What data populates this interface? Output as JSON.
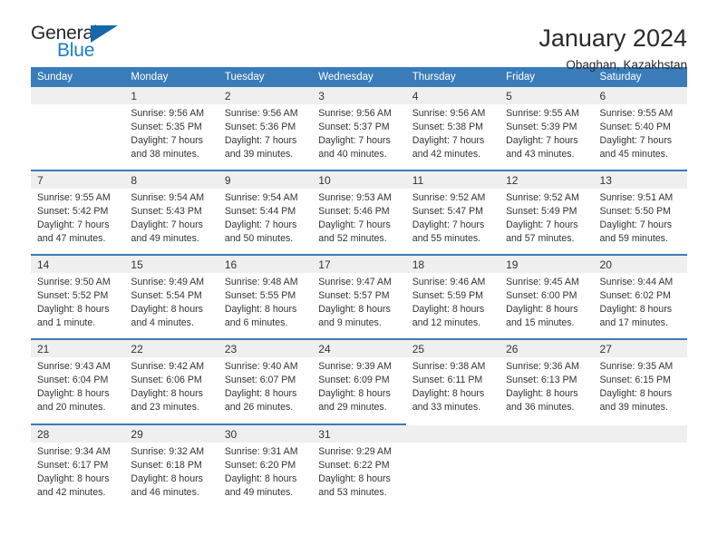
{
  "logo": {
    "word_top": "General",
    "word_bottom": "Blue",
    "triangle_color": "#1667ab",
    "blue_color": "#1c7ec6"
  },
  "header": {
    "title": "January 2024",
    "subtitle": "Obaghan, Kazakhstan"
  },
  "theme": {
    "header_bg": "#3a7cba",
    "daynum_bg": "#efefef",
    "text": "#333333"
  },
  "weekday_headers": [
    "Sunday",
    "Monday",
    "Tuesday",
    "Wednesday",
    "Thursday",
    "Friday",
    "Saturday"
  ],
  "weeks": [
    {
      "days": [
        {
          "num": "",
          "sunrise": "",
          "sunset": "",
          "daylight1": "",
          "daylight2": ""
        },
        {
          "num": "1",
          "sunrise": "Sunrise: 9:56 AM",
          "sunset": "Sunset: 5:35 PM",
          "daylight1": "Daylight: 7 hours",
          "daylight2": "and 38 minutes."
        },
        {
          "num": "2",
          "sunrise": "Sunrise: 9:56 AM",
          "sunset": "Sunset: 5:36 PM",
          "daylight1": "Daylight: 7 hours",
          "daylight2": "and 39 minutes."
        },
        {
          "num": "3",
          "sunrise": "Sunrise: 9:56 AM",
          "sunset": "Sunset: 5:37 PM",
          "daylight1": "Daylight: 7 hours",
          "daylight2": "and 40 minutes."
        },
        {
          "num": "4",
          "sunrise": "Sunrise: 9:56 AM",
          "sunset": "Sunset: 5:38 PM",
          "daylight1": "Daylight: 7 hours",
          "daylight2": "and 42 minutes."
        },
        {
          "num": "5",
          "sunrise": "Sunrise: 9:55 AM",
          "sunset": "Sunset: 5:39 PM",
          "daylight1": "Daylight: 7 hours",
          "daylight2": "and 43 minutes."
        },
        {
          "num": "6",
          "sunrise": "Sunrise: 9:55 AM",
          "sunset": "Sunset: 5:40 PM",
          "daylight1": "Daylight: 7 hours",
          "daylight2": "and 45 minutes."
        }
      ]
    },
    {
      "days": [
        {
          "num": "7",
          "sunrise": "Sunrise: 9:55 AM",
          "sunset": "Sunset: 5:42 PM",
          "daylight1": "Daylight: 7 hours",
          "daylight2": "and 47 minutes."
        },
        {
          "num": "8",
          "sunrise": "Sunrise: 9:54 AM",
          "sunset": "Sunset: 5:43 PM",
          "daylight1": "Daylight: 7 hours",
          "daylight2": "and 49 minutes."
        },
        {
          "num": "9",
          "sunrise": "Sunrise: 9:54 AM",
          "sunset": "Sunset: 5:44 PM",
          "daylight1": "Daylight: 7 hours",
          "daylight2": "and 50 minutes."
        },
        {
          "num": "10",
          "sunrise": "Sunrise: 9:53 AM",
          "sunset": "Sunset: 5:46 PM",
          "daylight1": "Daylight: 7 hours",
          "daylight2": "and 52 minutes."
        },
        {
          "num": "11",
          "sunrise": "Sunrise: 9:52 AM",
          "sunset": "Sunset: 5:47 PM",
          "daylight1": "Daylight: 7 hours",
          "daylight2": "and 55 minutes."
        },
        {
          "num": "12",
          "sunrise": "Sunrise: 9:52 AM",
          "sunset": "Sunset: 5:49 PM",
          "daylight1": "Daylight: 7 hours",
          "daylight2": "and 57 minutes."
        },
        {
          "num": "13",
          "sunrise": "Sunrise: 9:51 AM",
          "sunset": "Sunset: 5:50 PM",
          "daylight1": "Daylight: 7 hours",
          "daylight2": "and 59 minutes."
        }
      ]
    },
    {
      "days": [
        {
          "num": "14",
          "sunrise": "Sunrise: 9:50 AM",
          "sunset": "Sunset: 5:52 PM",
          "daylight1": "Daylight: 8 hours",
          "daylight2": "and 1 minute."
        },
        {
          "num": "15",
          "sunrise": "Sunrise: 9:49 AM",
          "sunset": "Sunset: 5:54 PM",
          "daylight1": "Daylight: 8 hours",
          "daylight2": "and 4 minutes."
        },
        {
          "num": "16",
          "sunrise": "Sunrise: 9:48 AM",
          "sunset": "Sunset: 5:55 PM",
          "daylight1": "Daylight: 8 hours",
          "daylight2": "and 6 minutes."
        },
        {
          "num": "17",
          "sunrise": "Sunrise: 9:47 AM",
          "sunset": "Sunset: 5:57 PM",
          "daylight1": "Daylight: 8 hours",
          "daylight2": "and 9 minutes."
        },
        {
          "num": "18",
          "sunrise": "Sunrise: 9:46 AM",
          "sunset": "Sunset: 5:59 PM",
          "daylight1": "Daylight: 8 hours",
          "daylight2": "and 12 minutes."
        },
        {
          "num": "19",
          "sunrise": "Sunrise: 9:45 AM",
          "sunset": "Sunset: 6:00 PM",
          "daylight1": "Daylight: 8 hours",
          "daylight2": "and 15 minutes."
        },
        {
          "num": "20",
          "sunrise": "Sunrise: 9:44 AM",
          "sunset": "Sunset: 6:02 PM",
          "daylight1": "Daylight: 8 hours",
          "daylight2": "and 17 minutes."
        }
      ]
    },
    {
      "days": [
        {
          "num": "21",
          "sunrise": "Sunrise: 9:43 AM",
          "sunset": "Sunset: 6:04 PM",
          "daylight1": "Daylight: 8 hours",
          "daylight2": "and 20 minutes."
        },
        {
          "num": "22",
          "sunrise": "Sunrise: 9:42 AM",
          "sunset": "Sunset: 6:06 PM",
          "daylight1": "Daylight: 8 hours",
          "daylight2": "and 23 minutes."
        },
        {
          "num": "23",
          "sunrise": "Sunrise: 9:40 AM",
          "sunset": "Sunset: 6:07 PM",
          "daylight1": "Daylight: 8 hours",
          "daylight2": "and 26 minutes."
        },
        {
          "num": "24",
          "sunrise": "Sunrise: 9:39 AM",
          "sunset": "Sunset: 6:09 PM",
          "daylight1": "Daylight: 8 hours",
          "daylight2": "and 29 minutes."
        },
        {
          "num": "25",
          "sunrise": "Sunrise: 9:38 AM",
          "sunset": "Sunset: 6:11 PM",
          "daylight1": "Daylight: 8 hours",
          "daylight2": "and 33 minutes."
        },
        {
          "num": "26",
          "sunrise": "Sunrise: 9:36 AM",
          "sunset": "Sunset: 6:13 PM",
          "daylight1": "Daylight: 8 hours",
          "daylight2": "and 36 minutes."
        },
        {
          "num": "27",
          "sunrise": "Sunrise: 9:35 AM",
          "sunset": "Sunset: 6:15 PM",
          "daylight1": "Daylight: 8 hours",
          "daylight2": "and 39 minutes."
        }
      ]
    },
    {
      "days": [
        {
          "num": "28",
          "sunrise": "Sunrise: 9:34 AM",
          "sunset": "Sunset: 6:17 PM",
          "daylight1": "Daylight: 8 hours",
          "daylight2": "and 42 minutes."
        },
        {
          "num": "29",
          "sunrise": "Sunrise: 9:32 AM",
          "sunset": "Sunset: 6:18 PM",
          "daylight1": "Daylight: 8 hours",
          "daylight2": "and 46 minutes."
        },
        {
          "num": "30",
          "sunrise": "Sunrise: 9:31 AM",
          "sunset": "Sunset: 6:20 PM",
          "daylight1": "Daylight: 8 hours",
          "daylight2": "and 49 minutes."
        },
        {
          "num": "31",
          "sunrise": "Sunrise: 9:29 AM",
          "sunset": "Sunset: 6:22 PM",
          "daylight1": "Daylight: 8 hours",
          "daylight2": "and 53 minutes."
        },
        {
          "num": "",
          "sunrise": "",
          "sunset": "",
          "daylight1": "",
          "daylight2": ""
        },
        {
          "num": "",
          "sunrise": "",
          "sunset": "",
          "daylight1": "",
          "daylight2": ""
        },
        {
          "num": "",
          "sunrise": "",
          "sunset": "",
          "daylight1": "",
          "daylight2": ""
        }
      ]
    }
  ]
}
